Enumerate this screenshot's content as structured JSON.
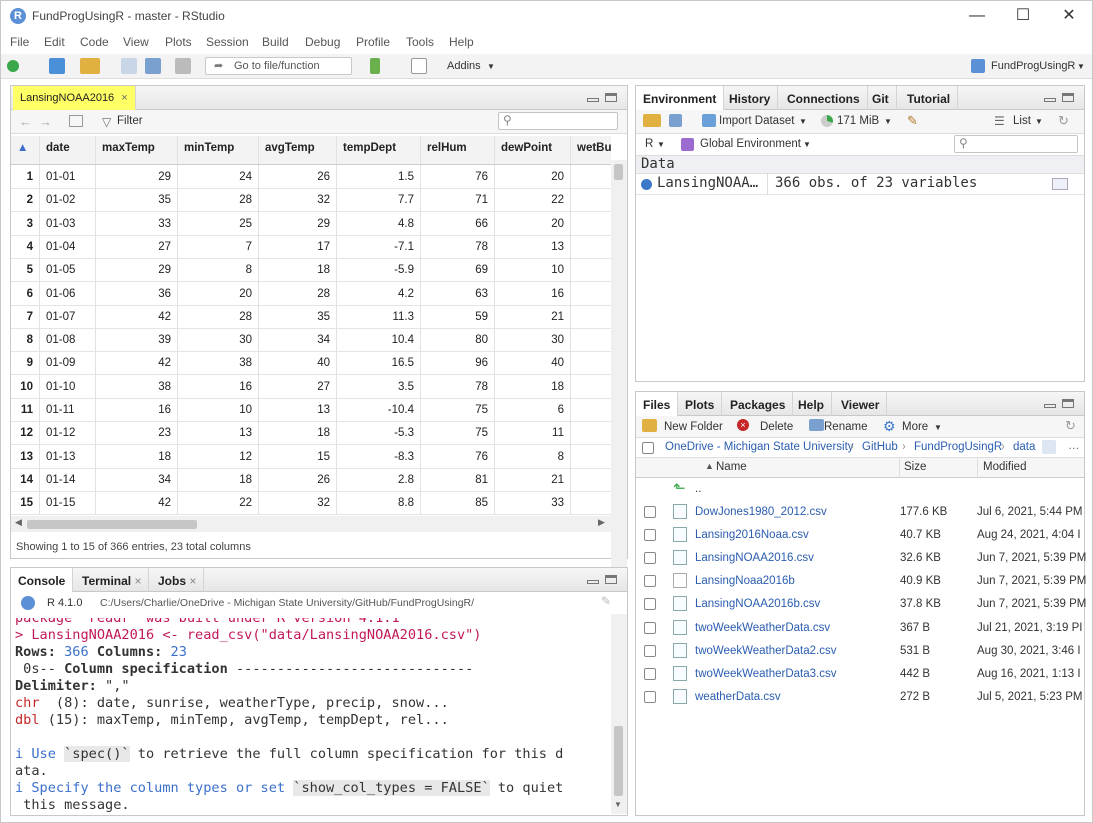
{
  "window": {
    "title": "FundProgUsingR - master - RStudio",
    "logo_letter": "R"
  },
  "menu": [
    "File",
    "Edit",
    "Code",
    "View",
    "Plots",
    "Session",
    "Build",
    "Debug",
    "Profile",
    "Tools",
    "Help"
  ],
  "toolbar": {
    "goto_placeholder": "Go to file/function",
    "addins_label": "Addins",
    "project_label": "FundProgUsingR"
  },
  "source": {
    "tab_label": "LansingNOAA2016",
    "filter_label": "Filter",
    "columns": [
      "date",
      "maxTemp",
      "minTemp",
      "avgTemp",
      "tempDept",
      "relHum",
      "dewPoint",
      "wetBulbTe"
    ],
    "rows": [
      [
        "1",
        "01-01",
        "29",
        "24",
        "26",
        "1.5",
        "76",
        "20"
      ],
      [
        "2",
        "01-02",
        "35",
        "28",
        "32",
        "7.7",
        "71",
        "22"
      ],
      [
        "3",
        "01-03",
        "33",
        "25",
        "29",
        "4.8",
        "66",
        "20"
      ],
      [
        "4",
        "01-04",
        "27",
        "7",
        "17",
        "-7.1",
        "78",
        "13"
      ],
      [
        "5",
        "01-05",
        "29",
        "8",
        "18",
        "-5.9",
        "69",
        "10"
      ],
      [
        "6",
        "01-06",
        "36",
        "20",
        "28",
        "4.2",
        "63",
        "16"
      ],
      [
        "7",
        "01-07",
        "42",
        "28",
        "35",
        "11.3",
        "59",
        "21"
      ],
      [
        "8",
        "01-08",
        "39",
        "30",
        "34",
        "10.4",
        "80",
        "30"
      ],
      [
        "9",
        "01-09",
        "42",
        "38",
        "40",
        "16.5",
        "96",
        "40"
      ],
      [
        "10",
        "01-10",
        "38",
        "16",
        "27",
        "3.5",
        "78",
        "18"
      ],
      [
        "11",
        "01-11",
        "16",
        "10",
        "13",
        "-10.4",
        "75",
        "6"
      ],
      [
        "12",
        "01-12",
        "23",
        "13",
        "18",
        "-5.3",
        "75",
        "11"
      ],
      [
        "13",
        "01-13",
        "18",
        "12",
        "15",
        "-8.3",
        "76",
        "8"
      ],
      [
        "14",
        "01-14",
        "34",
        "18",
        "26",
        "2.8",
        "81",
        "21"
      ],
      [
        "15",
        "01-15",
        "42",
        "22",
        "32",
        "8.8",
        "85",
        "33"
      ]
    ],
    "status": "Showing 1 to 15 of 366 entries, 23 total columns"
  },
  "console": {
    "tabs": [
      "Console",
      "Terminal",
      "Jobs"
    ],
    "r_version": "R 4.1.0",
    "path": "C:/Users/Charlie/OneDrive - Michigan State University/GitHub/FundProgUsingR/",
    "lines": {
      "l0": "package 'readr' was built under R version 4.1.1",
      "l1": "> LansingNOAA2016 <- read_csv(\"data/LansingNOAA2016.csv\")",
      "l2a": "Rows: ",
      "l2b": "366",
      "l2c": " Columns: ",
      "l2d": "23",
      "l3a": " 0s-- ",
      "l3b": "Column specification",
      "l3c": " -----------------------------",
      "l4a": "Delimiter: ",
      "l4b": "\",\"",
      "l5a": "chr",
      "l5b": "  (8): date, sunrise, weatherType, precip, snow...",
      "l6a": "dbl",
      "l6b": " (15): maxTemp, minTemp, avgTemp, tempDept, rel...",
      "l8a": "i Use ",
      "l8b": "`spec()`",
      "l8c": " to retrieve the full column specification for this d",
      "l9": "ata.",
      "l10a": "i Specify the column types or set ",
      "l10b": "`show_col_types = FALSE`",
      "l10c": " to quiet",
      "l11": " this message."
    }
  },
  "environment": {
    "tabs": [
      "Environment",
      "History",
      "Connections",
      "Git",
      "Tutorial"
    ],
    "import_label": "Import Dataset",
    "memory": "171 MiB",
    "list_label": "List",
    "lang": "R",
    "scope": "Global Environment",
    "section": "Data",
    "item_name": "LansingNOAA…",
    "item_value": "366 obs. of 23 variables"
  },
  "files": {
    "tabs": [
      "Files",
      "Plots",
      "Packages",
      "Help",
      "Viewer"
    ],
    "actions": {
      "new_folder": "New Folder",
      "delete": "Delete",
      "rename": "Rename",
      "more": "More"
    },
    "breadcrumb": [
      "OneDrive - Michigan State University",
      "GitHub",
      "FundProgUsingR",
      "data"
    ],
    "headers": {
      "name": "Name",
      "size": "Size",
      "modified": "Modified"
    },
    "up": "..",
    "list": [
      {
        "name": "DowJones1980_2012.csv",
        "size": "177.6 KB",
        "modified": "Jul 6, 2021, 5:44 PM"
      },
      {
        "name": "Lansing2016Noaa.csv",
        "size": "40.7 KB",
        "modified": "Aug 24, 2021, 4:04 I"
      },
      {
        "name": "LansingNOAA2016.csv",
        "size": "32.6 KB",
        "modified": "Jun 7, 2021, 5:39 PM"
      },
      {
        "name": "LansingNoaa2016b",
        "size": "40.9 KB",
        "modified": "Jun 7, 2021, 5:39 PM"
      },
      {
        "name": "LansingNOAA2016b.csv",
        "size": "37.8 KB",
        "modified": "Jun 7, 2021, 5:39 PM"
      },
      {
        "name": "twoWeekWeatherData.csv",
        "size": "367 B",
        "modified": "Jul 21, 2021, 3:19 PI"
      },
      {
        "name": "twoWeekWeatherData2.csv",
        "size": "531 B",
        "modified": "Aug 30, 2021, 3:46 I"
      },
      {
        "name": "twoWeekWeatherData3.csv",
        "size": "442 B",
        "modified": "Aug 16, 2021, 1:13 I"
      },
      {
        "name": "weatherData.csv",
        "size": "272 B",
        "modified": "Jul 5, 2021, 5:23 PM"
      }
    ]
  },
  "colors": {
    "accent": "#2a5db0",
    "highlight": "#ffff66",
    "console_magenta": "#c2185b"
  }
}
